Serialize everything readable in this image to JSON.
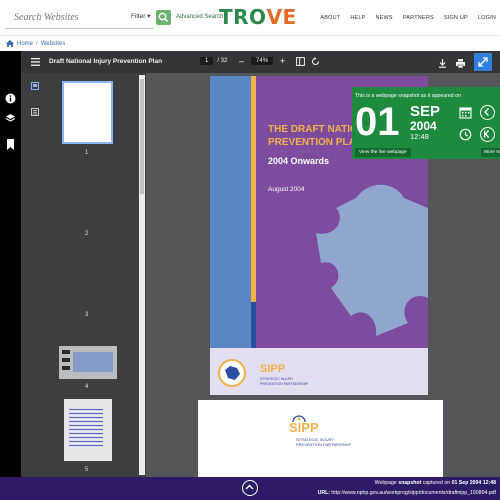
{
  "header": {
    "search_placeholder": "Search Websites",
    "filter_label": "Filter",
    "advanced_search_label": "Advanced Search",
    "logo_text_a": "TR",
    "logo_text_b": "O",
    "logo_text_c": "VE",
    "nav": [
      "ABOUT",
      "HELP",
      "NEWS",
      "PARTNERS",
      "SIGN UP",
      "LOGIN"
    ]
  },
  "breadcrumb": {
    "home": "Home",
    "separator": "/",
    "section": "Websites"
  },
  "viewer": {
    "title": "Draft National Injury Prevention Plan",
    "current_page": "1",
    "page_count": "/ 32",
    "zoom": "74%",
    "thumbnail_numbers": [
      "1",
      "2",
      "3",
      "4",
      "5"
    ]
  },
  "document": {
    "cover_title_line1": "THE DRAFT NATIONAL",
    "cover_title_line2": "PREVENTION PLAN",
    "cover_subtitle": "2004 Onwards",
    "cover_date": "August 2004",
    "logo_name": "SIPP",
    "logo_tagline_1": "STRATEGIC INJURY",
    "logo_tagline_2": "PREVENTION PARTNERSHIP"
  },
  "snapshot": {
    "caption": "This is a webpage snapshot as it appeared on",
    "day": "01",
    "month": "SEP",
    "year": "2004",
    "time": "12:48",
    "live_version_label": "View the live webpage",
    "more_label": "More sn"
  },
  "footer": {
    "line1_prefix": "Webpage ",
    "line1_bold": "snapshot",
    "line1_mid": " captured on ",
    "line1_date": "01 Sep 2004 12:48",
    "url_label": "URL:",
    "url": "http://www.nphp.gov.au/workprog/sipp/documents/draftnipp_190804.pdf"
  },
  "colors": {
    "brand_green": "#1d8a3e",
    "footer_purple": "#2f1a66",
    "cover_purple": "#7d4c9e",
    "cover_stripe_blue": "#5b86c5",
    "cover_stripe_orange": "#f1b24a",
    "accent_blue": "#2f7fdb"
  }
}
